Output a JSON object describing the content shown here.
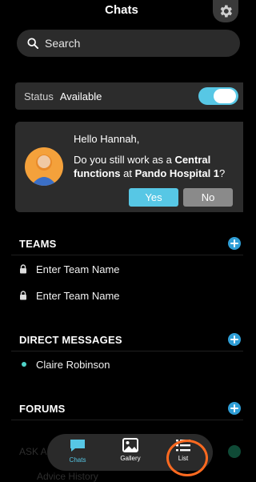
{
  "header": {
    "title": "Chats",
    "settings_icon": "gear-icon"
  },
  "search": {
    "placeholder": "Search"
  },
  "status": {
    "label": "Status",
    "value": "Available",
    "toggle_on": true
  },
  "prompt": {
    "greeting": "Hello Hannah,",
    "question_prefix": "Do you still work as a ",
    "role": "Central functions",
    "question_mid": " at ",
    "place": "Pando Hospital 1",
    "question_suffix": "?",
    "yes_label": "Yes",
    "no_label": "No"
  },
  "teams": {
    "title": "TEAMS",
    "items": [
      {
        "label": "Enter Team Name",
        "icon": "lock-icon"
      },
      {
        "label": "Enter Team Name",
        "icon": "lock-icon"
      }
    ]
  },
  "direct_messages": {
    "title": "DIRECT MESSAGES",
    "items": [
      {
        "label": "Claire Robinson",
        "status": "online"
      }
    ]
  },
  "forums": {
    "title": "FORUMS"
  },
  "ask": {
    "title": "ASK A",
    "items": [
      {
        "label": "Advice History"
      }
    ]
  },
  "tabbar": {
    "tabs": [
      {
        "label": "Chats",
        "icon": "chat-bubble-icon",
        "active": true
      },
      {
        "label": "Gallery",
        "icon": "image-icon",
        "active": false
      },
      {
        "label": "List",
        "icon": "list-icon",
        "active": false
      }
    ]
  },
  "colors": {
    "accent": "#57c7e5",
    "plus": "#2f9ed6",
    "highlight_ring": "#ff6a20",
    "online": "#4fd3c8"
  }
}
